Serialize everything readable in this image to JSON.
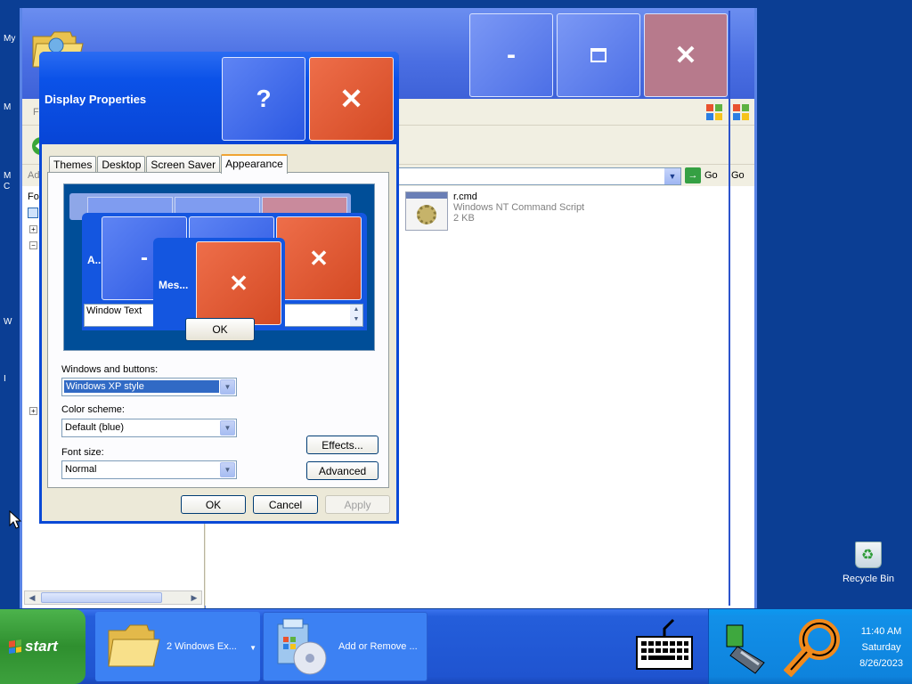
{
  "desktop": {
    "edge_labels": [
      "My",
      "M",
      "M",
      "C",
      "W",
      "I"
    ],
    "recycle_bin_label": "Recycle Bin"
  },
  "explorer": {
    "menubar_clip": "Fi",
    "address_clip": "Ad",
    "folders_clip": "Fo",
    "go_label": "Go",
    "go_clip": "Go",
    "file": {
      "name": "r.cmd",
      "type": "Windows NT Command Script",
      "size": "2 KB"
    },
    "title_buttons": {
      "minimize": "-",
      "close": "✕"
    }
  },
  "dialog": {
    "title": "Display Properties",
    "help_glyph": "?",
    "close_glyph": "✕",
    "tabs": [
      "Themes",
      "Desktop",
      "Screen Saver",
      "Appearance"
    ],
    "active_tab": "Appearance",
    "preview": {
      "inactive_window_label": "A...",
      "message_box_label": "Mes...",
      "window_text": "Window Text",
      "ok_label": "OK",
      "min_glyph": "-",
      "close_glyph": "✕"
    },
    "windows_buttons_label": "Windows and buttons:",
    "windows_buttons_value": "Windows XP style",
    "color_scheme_label": "Color scheme:",
    "color_scheme_value": "Default (blue)",
    "font_size_label": "Font size:",
    "font_size_value": "Normal",
    "effects_label": "Effects...",
    "advanced_label": "Advanced",
    "ok_label": "OK",
    "cancel_label": "Cancel",
    "apply_label": "Apply"
  },
  "taskbar": {
    "start_label": "start",
    "items": [
      {
        "label": "2 Windows Ex...",
        "icon": "folder-icon"
      },
      {
        "label": "Add or Remove ...",
        "icon": "add-remove-programs-icon"
      }
    ],
    "clock": {
      "time": "11:40 AM",
      "day": "Saturday",
      "date": "8/26/2023"
    }
  },
  "colors": {
    "desktop_bg": "#0b3e94",
    "taskbar": "#245edb",
    "start_green": "#3da13d",
    "dialog_blue": "#0845d6",
    "close_red": "#d44a24",
    "selection_blue": "#316ac5"
  }
}
